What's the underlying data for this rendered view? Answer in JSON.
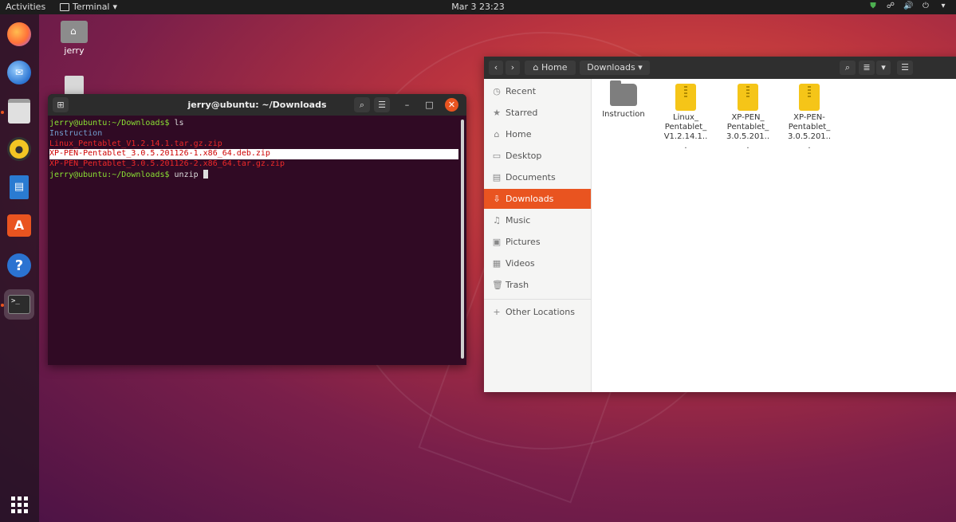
{
  "topbar": {
    "activities": "Activities",
    "app_name": "Terminal",
    "clock": "Mar 3  23:23",
    "tray_icons": [
      "shield-icon",
      "network-icon",
      "volume-icon",
      "power-icon"
    ]
  },
  "dock": {
    "items": [
      "firefox-icon",
      "thunderbird-icon",
      "files-icon",
      "rhythmbox-icon",
      "writer-icon",
      "software-icon",
      "help-icon",
      "terminal-icon"
    ],
    "show_apps": "show-applications-icon"
  },
  "desktop": {
    "home_label": "jerry"
  },
  "terminal": {
    "title": "jerry@ubuntu: ~/Downloads",
    "lines": {
      "cmd1_prompt": "jerry@ubuntu:~/Downloads$",
      "cmd1": " ls",
      "entry1": "Instruction",
      "entry2": "Linux_Pentablet_V1.2.14.1.tar.gz.zip",
      "entry3": "XP-PEN-Pentablet_3.0.5.201126-1.x86_64.deb.zip",
      "entry4": "XP-PEN_Pentablet_3.0.5.201126-2.x86_64.tar.gz.zip",
      "cmd2_prompt": "jerry@ubuntu:~/Downloads$",
      "cmd2": " unzip "
    }
  },
  "files": {
    "path_home": "Home",
    "path_current": "Downloads",
    "sidebar": [
      {
        "icon": "clock-icon",
        "glyph": "◷",
        "label": "Recent"
      },
      {
        "icon": "star-icon",
        "glyph": "★",
        "label": "Starred"
      },
      {
        "icon": "home-icon",
        "glyph": "⌂",
        "label": "Home"
      },
      {
        "icon": "desktop-icon",
        "glyph": "▭",
        "label": "Desktop"
      },
      {
        "icon": "documents-icon",
        "glyph": "▤",
        "label": "Documents"
      },
      {
        "icon": "downloads-icon",
        "glyph": "⇩",
        "label": "Downloads"
      },
      {
        "icon": "music-icon",
        "glyph": "♫",
        "label": "Music"
      },
      {
        "icon": "pictures-icon",
        "glyph": "▣",
        "label": "Pictures"
      },
      {
        "icon": "videos-icon",
        "glyph": "▦",
        "label": "Videos"
      },
      {
        "icon": "trash-icon",
        "glyph": "🗑",
        "label": "Trash"
      },
      {
        "icon": "plus-icon",
        "glyph": "+",
        "label": "Other Locations"
      }
    ],
    "active_item": "Downloads",
    "items": [
      {
        "type": "folder",
        "name": "Instruction"
      },
      {
        "type": "zip",
        "name": "Linux_ Pentablet_ V1.2.14.1..."
      },
      {
        "type": "zip",
        "name": "XP-PEN_ Pentablet_ 3.0.5.201..."
      },
      {
        "type": "zip",
        "name": "XP-PEN- Pentablet_ 3.0.5.201..."
      }
    ]
  },
  "colors": {
    "accent": "#e95420",
    "terminal_bg": "#300a24"
  }
}
